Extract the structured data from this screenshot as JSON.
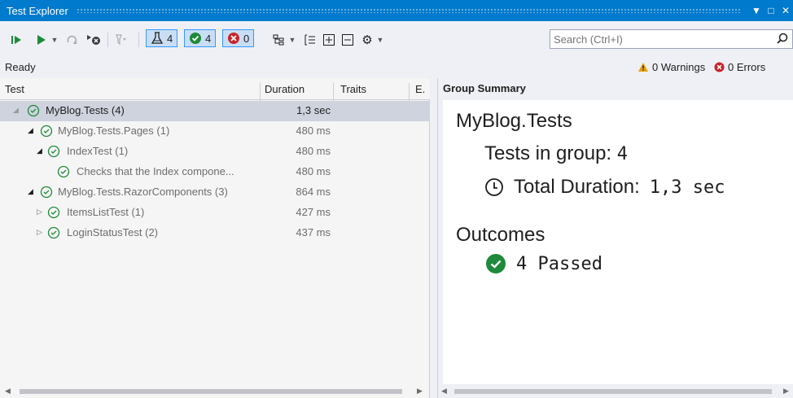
{
  "window": {
    "title": "Test Explorer",
    "controls": [
      "▼",
      "□",
      "✕"
    ]
  },
  "toolbar": {
    "counts": {
      "total": "4",
      "passed": "4",
      "failed": "0"
    },
    "search": {
      "placeholder": "Search (Ctrl+I)",
      "value": ""
    }
  },
  "status": {
    "state": "Ready",
    "warnings": "0 Warnings",
    "errors": "0 Errors"
  },
  "tree": {
    "columns": [
      "Test",
      "Duration",
      "Traits",
      "E."
    ],
    "rows": [
      {
        "name": "MyBlog.Tests (4)",
        "duration": "1,3 sec"
      },
      {
        "name": "MyBlog.Tests.Pages (1)",
        "duration": "480 ms"
      },
      {
        "name": "IndexTest (1)",
        "duration": "480 ms"
      },
      {
        "name": "Checks that the Index compone...",
        "duration": "480 ms"
      },
      {
        "name": "MyBlog.Tests.RazorComponents (3)",
        "duration": "864 ms"
      },
      {
        "name": "ItemsListTest (1)",
        "duration": "427 ms"
      },
      {
        "name": "LoginStatusTest (2)",
        "duration": "437 ms"
      }
    ]
  },
  "summary": {
    "header": "Group Summary",
    "group_name": "MyBlog.Tests",
    "tests_label": "Tests in group:",
    "tests_value": "4",
    "duration_label": "Total Duration:",
    "duration_value": "1,3 sec",
    "outcomes_label": "Outcomes",
    "passed_value": "4 Passed"
  },
  "colors": {
    "accent": "#007acc",
    "pass": "#1e8a3a",
    "fail": "#c8262c",
    "warn": "#e8a202"
  }
}
